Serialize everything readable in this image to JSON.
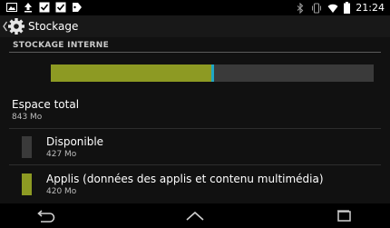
{
  "status_bar": {
    "notifications": [
      "image-icon",
      "upload-icon",
      "checkbox-icon",
      "checkbox-icon",
      "tag-icon"
    ],
    "system": [
      "bluetooth-icon",
      "vibrate-icon",
      "wifi-icon",
      "battery-icon"
    ],
    "time": "21:24"
  },
  "action_bar": {
    "title": "Stockage",
    "icon": "settings-gear-icon"
  },
  "section": {
    "header": "STOCKAGE INTERNE"
  },
  "storage_bar": {
    "used_fraction": 0.4988,
    "colors": {
      "used": "#8d9a23",
      "free": "#3a3a3a",
      "separator": "#1fa7c4"
    }
  },
  "items": [
    {
      "title": "Espace total",
      "value": "843 Mo"
    },
    {
      "title": "Disponible",
      "value": "427 Mo",
      "color": "#3a3a3a"
    },
    {
      "title": "Applis (données des applis et contenu multimédia)",
      "value": "420 Mo",
      "color": "#8d9a23"
    }
  ],
  "nav_bar": {
    "buttons": [
      "back-icon",
      "home-icon",
      "recent-apps-icon"
    ]
  }
}
